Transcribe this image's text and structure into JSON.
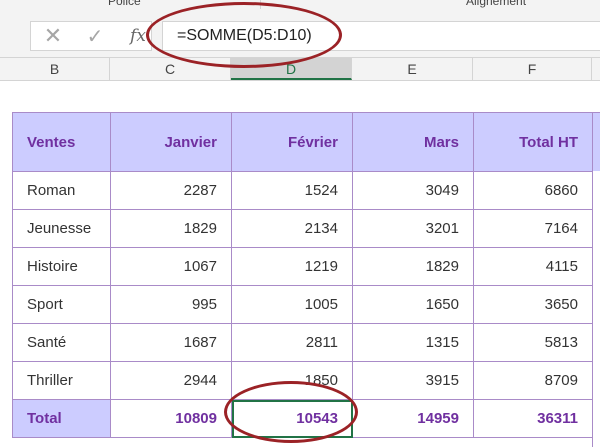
{
  "ribbon": {
    "groups": [
      "Police",
      "Alignement"
    ]
  },
  "formula_bar": {
    "cancel_icon": "✕",
    "enter_icon": "✓",
    "fx_label": "fx",
    "formula": "=SOMME(D5:D10)"
  },
  "columns": [
    "B",
    "C",
    "D",
    "E",
    "F"
  ],
  "active_column": "D",
  "table": {
    "headers": [
      "Ventes",
      "Janvier",
      "Février",
      "Mars",
      "Total HT"
    ],
    "rows": [
      [
        "Roman",
        "2287",
        "1524",
        "3049",
        "6860"
      ],
      [
        "Jeunesse",
        "1829",
        "2134",
        "3201",
        "7164"
      ],
      [
        "Histoire",
        "1067",
        "1219",
        "1829",
        "4115"
      ],
      [
        "Sport",
        "995",
        "1005",
        "1650",
        "3650"
      ],
      [
        "Santé",
        "1687",
        "2811",
        "1315",
        "5813"
      ],
      [
        "Thriller",
        "2944",
        "1850",
        "3915",
        "8709"
      ]
    ],
    "total": [
      "Total",
      "10809",
      "10543",
      "14959",
      "36311"
    ]
  },
  "colors": {
    "header_fill": "#ccccff",
    "header_text": "#7030a0",
    "border": "#a98bc8",
    "selection": "#217346",
    "annotation": "#9b2226"
  }
}
